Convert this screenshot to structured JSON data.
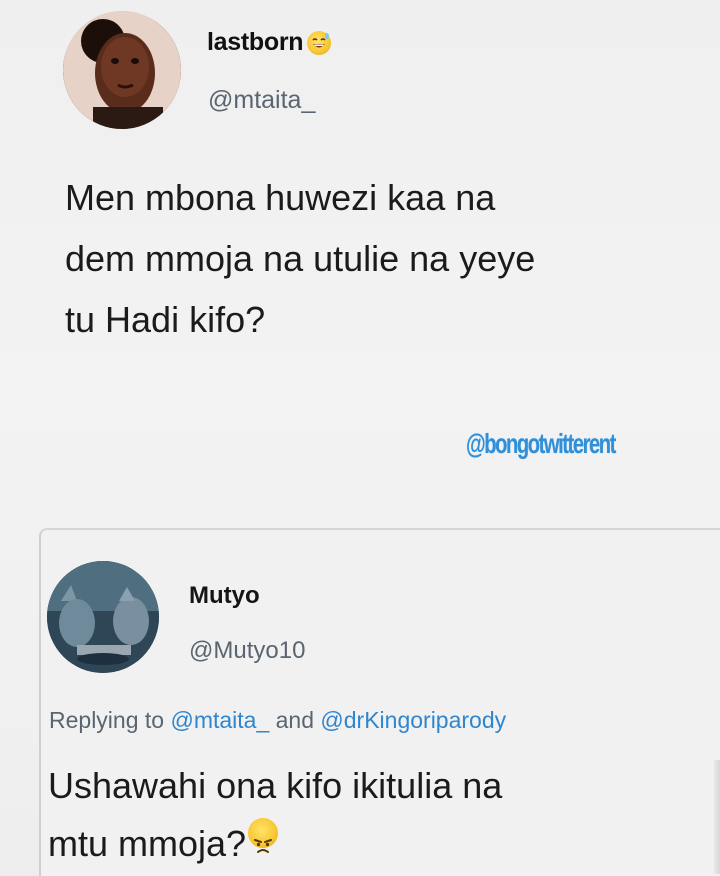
{
  "tweet": {
    "author": {
      "display_name": "lastborn",
      "display_name_emoji": "grinning-sweat-emoji",
      "handle": "@mtaita_"
    },
    "text_lines": [
      "Men mbona huwezi kaa na",
      "dem mmoja na utulie na yeye",
      "tu Hadi kifo?"
    ],
    "watermark": "@bongotwitterent"
  },
  "reply": {
    "author": {
      "display_name": "Mutyo",
      "handle": "@Mutyo10"
    },
    "replying_prefix": "Replying to",
    "replying_mention_1": "@mtaita_",
    "replying_joiner": "and",
    "replying_mention_2": "@drKingoriparody",
    "text_lines": [
      "Ushawahi ona kifo ikitulia na",
      "mtu mmoja?"
    ],
    "text_emoji": "grumpy-face-emoji"
  },
  "colors": {
    "link_blue": "#2f86cf",
    "secondary_text": "#5b6570",
    "background": "#efefef"
  }
}
